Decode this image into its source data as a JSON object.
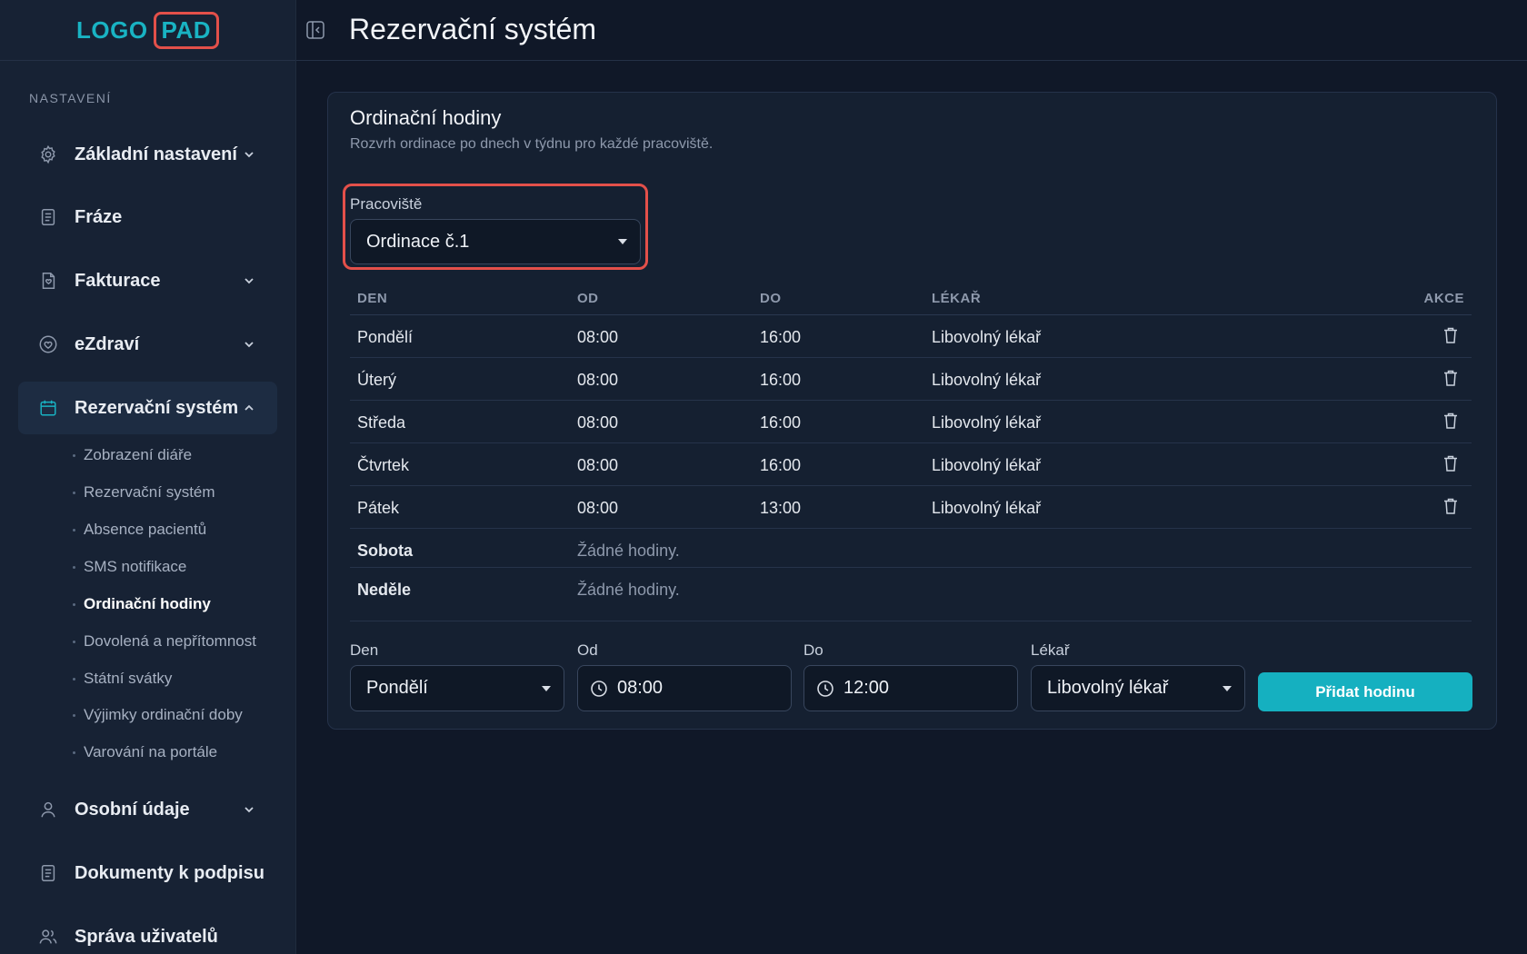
{
  "logo": {
    "part1": "LOGO",
    "part2": "PAD"
  },
  "header": {
    "title": "Rezervační systém"
  },
  "sidebar": {
    "section": "NASTAVENÍ",
    "items": [
      {
        "label": "Základní nastavení",
        "icon": "gear-icon"
      },
      {
        "label": "Fráze",
        "icon": "document-icon"
      },
      {
        "label": "Fakturace",
        "icon": "invoice-icon"
      },
      {
        "label": "eZdraví",
        "icon": "heart-icon"
      },
      {
        "label": "Rezervační systém",
        "icon": "calendar-icon"
      },
      {
        "label": "Osobní údaje",
        "icon": "user-icon"
      },
      {
        "label": "Dokumenty k podpisu",
        "icon": "document-icon"
      },
      {
        "label": "Správa uživatelů",
        "icon": "users-icon"
      }
    ],
    "subitems": [
      "Zobrazení diáře",
      "Rezervační systém",
      "Absence pacientů",
      "SMS notifikace",
      "Ordinační hodiny",
      "Dovolená a nepřítomnost",
      "Státní svátky",
      "Výjimky ordinační doby",
      "Varování na portále"
    ]
  },
  "card": {
    "title": "Ordinační hodiny",
    "description": "Rozvrh ordinace po dnech v týdnu pro každé pracoviště.",
    "workplace_label": "Pracoviště",
    "workplace_value": "Ordinace č.1"
  },
  "table": {
    "headers": {
      "day": "DEN",
      "from": "OD",
      "to": "DO",
      "doctor": "LÉKAŘ",
      "actions": "AKCE"
    },
    "rows": [
      {
        "day": "Pondělí",
        "from": "08:00",
        "to": "16:00",
        "doctor": "Libovolný lékař"
      },
      {
        "day": "Úterý",
        "from": "08:00",
        "to": "16:00",
        "doctor": "Libovolný lékař"
      },
      {
        "day": "Středa",
        "from": "08:00",
        "to": "16:00",
        "doctor": "Libovolný lékař"
      },
      {
        "day": "Čtvrtek",
        "from": "08:00",
        "to": "16:00",
        "doctor": "Libovolný lékař"
      },
      {
        "day": "Pátek",
        "from": "08:00",
        "to": "13:00",
        "doctor": "Libovolný lékař"
      }
    ],
    "empty_rows": [
      {
        "day": "Sobota",
        "note": "Žádné hodiny."
      },
      {
        "day": "Neděle",
        "note": "Žádné hodiny."
      }
    ]
  },
  "form": {
    "day_label": "Den",
    "day_value": "Pondělí",
    "from_label": "Od",
    "from_value": "08:00",
    "to_label": "Do",
    "to_value": "12:00",
    "doctor_label": "Lékař",
    "doctor_value": "Libovolný lékař",
    "add_button": "Přidat hodinu"
  },
  "colors": {
    "accent": "#15b0c0",
    "highlight": "#e3504a",
    "background": "#101828"
  }
}
